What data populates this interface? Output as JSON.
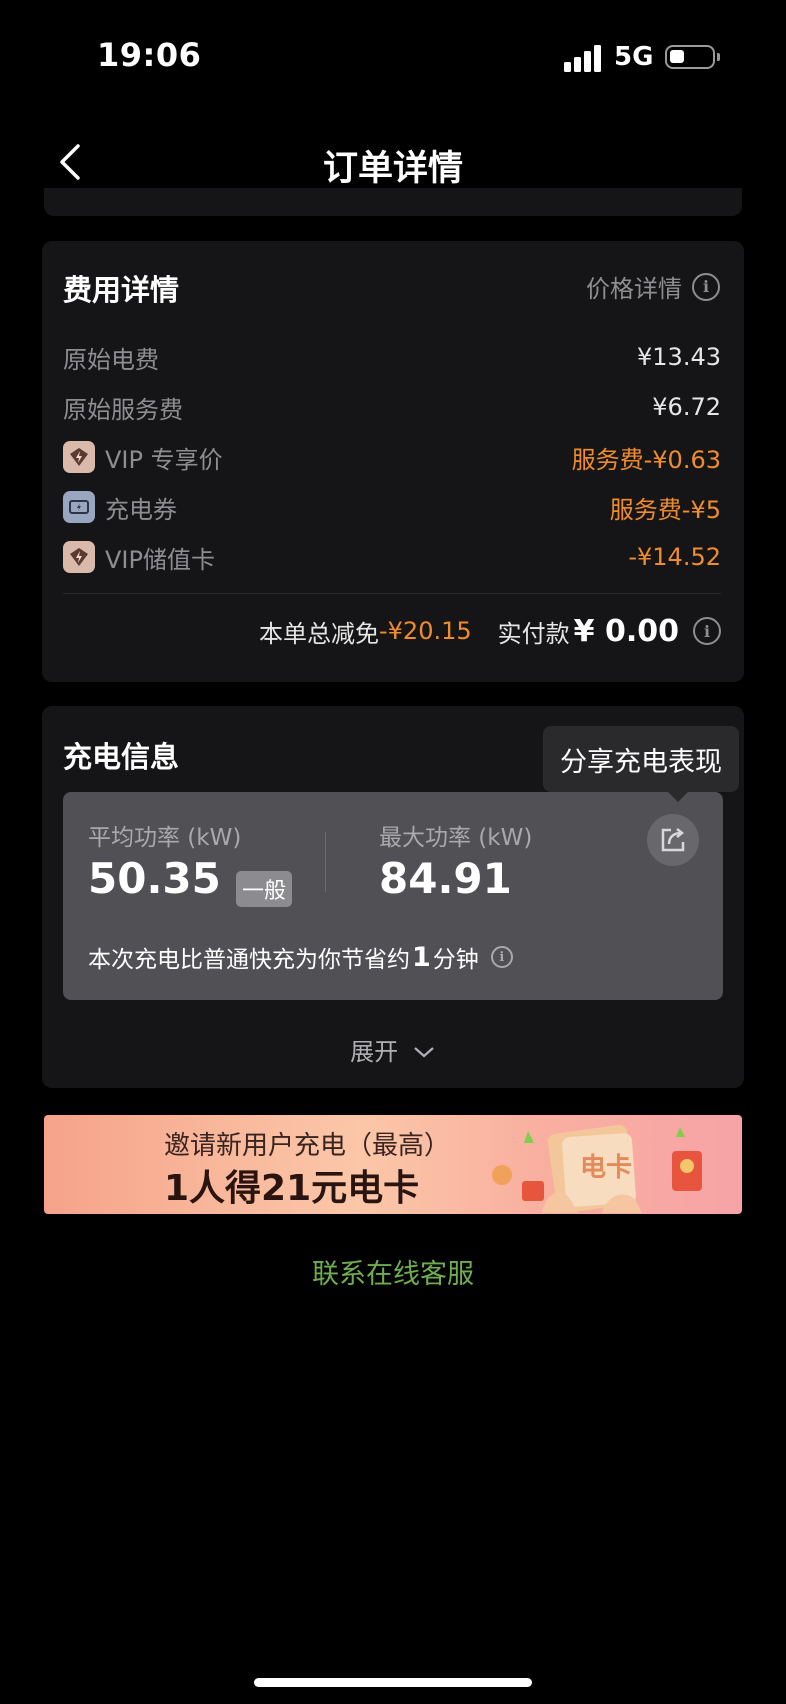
{
  "status_bar": {
    "time": "19:06",
    "network": "5G"
  },
  "nav": {
    "title": "订单详情"
  },
  "fee_card": {
    "title": "费用详情",
    "price_detail_link": "价格详情",
    "rows": [
      {
        "label": "原始电费",
        "value": "¥13.43",
        "icon": null,
        "highlight": false
      },
      {
        "label": "原始服务费",
        "value": "¥6.72",
        "icon": null,
        "highlight": false
      },
      {
        "label": "VIP 专享价",
        "value": "服务费-¥0.63",
        "icon": "vip-lightning-icon",
        "highlight": true
      },
      {
        "label": "充电券",
        "value": "服务费-¥5",
        "icon": "coupon-icon",
        "highlight": true
      },
      {
        "label": "VIP储值卡",
        "value": "-¥14.52",
        "icon": "vip-lightning-icon",
        "highlight": true
      }
    ],
    "summary": {
      "discount_label": "本单总减免",
      "discount_value": "-¥20.15",
      "paid_label": "实付款",
      "paid_currency": "¥",
      "paid_value": "0.00"
    }
  },
  "charge_card": {
    "title": "充电信息",
    "tooltip": "分享充电表现",
    "avg_power_label": "平均功率 (kW)",
    "avg_power_value": "50.35",
    "avg_power_level": "一般",
    "max_power_label": "最大功率 (kW)",
    "max_power_value": "84.91",
    "saving_prefix": "本次充电比普通快充为你节省约",
    "saving_number": "1",
    "saving_suffix": "分钟",
    "expand_label": "展开"
  },
  "banner": {
    "line1": "邀请新用户充电（最高）",
    "line2": "1人得21元电卡"
  },
  "contact": "联系在线客服",
  "colors": {
    "accent_orange": "#f08c2a",
    "contact_green": "#6fae4f",
    "card_bg": "#151517"
  }
}
